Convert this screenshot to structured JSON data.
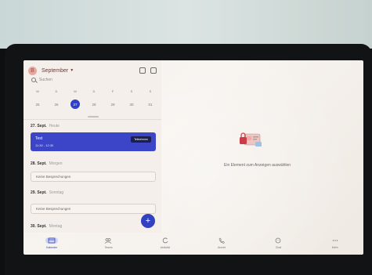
{
  "header": {
    "avatar_letter": "B",
    "month": "September"
  },
  "search": {
    "label": "Suchen"
  },
  "calendar": {
    "weekdays": [
      "M",
      "D",
      "M",
      "D",
      "F",
      "S",
      "S"
    ],
    "days": [
      "25",
      "26",
      "27",
      "28",
      "29",
      "30",
      "01"
    ],
    "selected_index": 2
  },
  "agenda": [
    {
      "date": "27. Sept.",
      "sub": "Heute"
    },
    {
      "date": "28. Sept.",
      "sub": "Morgen"
    },
    {
      "date": "29. Sept.",
      "sub": "Sonntag"
    },
    {
      "date": "30. Sept.",
      "sub": "Montag"
    }
  ],
  "event": {
    "title": "Test",
    "time": "11:30 - 12:30",
    "action": "Teilnehmen"
  },
  "empty_day_1": "Keine Besprechungen",
  "empty_day_2": "Keine Besprechungen",
  "detail": {
    "empty_message": "Ein Element zum Anzeigen auswählen"
  },
  "nav": [
    {
      "label": "Kalender",
      "icon": "calendar-icon"
    },
    {
      "label": "Teams",
      "icon": "teams-icon"
    },
    {
      "label": "Aktivität",
      "icon": "activity-icon"
    },
    {
      "label": "Anrufe",
      "icon": "phone-icon"
    },
    {
      "label": "Chat",
      "icon": "chat-icon"
    },
    {
      "label": "Mehr",
      "icon": "more-icon"
    }
  ],
  "colors": {
    "accent": "#3240c2",
    "event_bg": "#3c45c8"
  }
}
